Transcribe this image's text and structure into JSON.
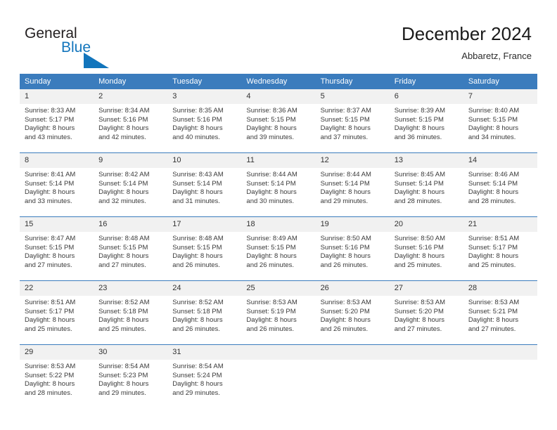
{
  "brand": {
    "name_dark": "General",
    "name_blue": "Blue",
    "accent_color": "#1275bc"
  },
  "header": {
    "title": "December 2024",
    "subtitle": "Abbaretz, France",
    "header_bg": "#3b7cbd",
    "daynum_bg": "#f1f1f1"
  },
  "weekday_headers": [
    "Sunday",
    "Monday",
    "Tuesday",
    "Wednesday",
    "Thursday",
    "Friday",
    "Saturday"
  ],
  "labels": {
    "sunrise": "Sunrise:",
    "sunset": "Sunset:",
    "daylight": "Daylight:"
  },
  "weeks": [
    [
      {
        "day": "1",
        "sunrise": "Sunrise: 8:33 AM",
        "sunset": "Sunset: 5:17 PM",
        "daylight_1": "Daylight: 8 hours",
        "daylight_2": "and 43 minutes."
      },
      {
        "day": "2",
        "sunrise": "Sunrise: 8:34 AM",
        "sunset": "Sunset: 5:16 PM",
        "daylight_1": "Daylight: 8 hours",
        "daylight_2": "and 42 minutes."
      },
      {
        "day": "3",
        "sunrise": "Sunrise: 8:35 AM",
        "sunset": "Sunset: 5:16 PM",
        "daylight_1": "Daylight: 8 hours",
        "daylight_2": "and 40 minutes."
      },
      {
        "day": "4",
        "sunrise": "Sunrise: 8:36 AM",
        "sunset": "Sunset: 5:15 PM",
        "daylight_1": "Daylight: 8 hours",
        "daylight_2": "and 39 minutes."
      },
      {
        "day": "5",
        "sunrise": "Sunrise: 8:37 AM",
        "sunset": "Sunset: 5:15 PM",
        "daylight_1": "Daylight: 8 hours",
        "daylight_2": "and 37 minutes."
      },
      {
        "day": "6",
        "sunrise": "Sunrise: 8:39 AM",
        "sunset": "Sunset: 5:15 PM",
        "daylight_1": "Daylight: 8 hours",
        "daylight_2": "and 36 minutes."
      },
      {
        "day": "7",
        "sunrise": "Sunrise: 8:40 AM",
        "sunset": "Sunset: 5:15 PM",
        "daylight_1": "Daylight: 8 hours",
        "daylight_2": "and 34 minutes."
      }
    ],
    [
      {
        "day": "8",
        "sunrise": "Sunrise: 8:41 AM",
        "sunset": "Sunset: 5:14 PM",
        "daylight_1": "Daylight: 8 hours",
        "daylight_2": "and 33 minutes."
      },
      {
        "day": "9",
        "sunrise": "Sunrise: 8:42 AM",
        "sunset": "Sunset: 5:14 PM",
        "daylight_1": "Daylight: 8 hours",
        "daylight_2": "and 32 minutes."
      },
      {
        "day": "10",
        "sunrise": "Sunrise: 8:43 AM",
        "sunset": "Sunset: 5:14 PM",
        "daylight_1": "Daylight: 8 hours",
        "daylight_2": "and 31 minutes."
      },
      {
        "day": "11",
        "sunrise": "Sunrise: 8:44 AM",
        "sunset": "Sunset: 5:14 PM",
        "daylight_1": "Daylight: 8 hours",
        "daylight_2": "and 30 minutes."
      },
      {
        "day": "12",
        "sunrise": "Sunrise: 8:44 AM",
        "sunset": "Sunset: 5:14 PM",
        "daylight_1": "Daylight: 8 hours",
        "daylight_2": "and 29 minutes."
      },
      {
        "day": "13",
        "sunrise": "Sunrise: 8:45 AM",
        "sunset": "Sunset: 5:14 PM",
        "daylight_1": "Daylight: 8 hours",
        "daylight_2": "and 28 minutes."
      },
      {
        "day": "14",
        "sunrise": "Sunrise: 8:46 AM",
        "sunset": "Sunset: 5:14 PM",
        "daylight_1": "Daylight: 8 hours",
        "daylight_2": "and 28 minutes."
      }
    ],
    [
      {
        "day": "15",
        "sunrise": "Sunrise: 8:47 AM",
        "sunset": "Sunset: 5:15 PM",
        "daylight_1": "Daylight: 8 hours",
        "daylight_2": "and 27 minutes."
      },
      {
        "day": "16",
        "sunrise": "Sunrise: 8:48 AM",
        "sunset": "Sunset: 5:15 PM",
        "daylight_1": "Daylight: 8 hours",
        "daylight_2": "and 27 minutes."
      },
      {
        "day": "17",
        "sunrise": "Sunrise: 8:48 AM",
        "sunset": "Sunset: 5:15 PM",
        "daylight_1": "Daylight: 8 hours",
        "daylight_2": "and 26 minutes."
      },
      {
        "day": "18",
        "sunrise": "Sunrise: 8:49 AM",
        "sunset": "Sunset: 5:15 PM",
        "daylight_1": "Daylight: 8 hours",
        "daylight_2": "and 26 minutes."
      },
      {
        "day": "19",
        "sunrise": "Sunrise: 8:50 AM",
        "sunset": "Sunset: 5:16 PM",
        "daylight_1": "Daylight: 8 hours",
        "daylight_2": "and 26 minutes."
      },
      {
        "day": "20",
        "sunrise": "Sunrise: 8:50 AM",
        "sunset": "Sunset: 5:16 PM",
        "daylight_1": "Daylight: 8 hours",
        "daylight_2": "and 25 minutes."
      },
      {
        "day": "21",
        "sunrise": "Sunrise: 8:51 AM",
        "sunset": "Sunset: 5:17 PM",
        "daylight_1": "Daylight: 8 hours",
        "daylight_2": "and 25 minutes."
      }
    ],
    [
      {
        "day": "22",
        "sunrise": "Sunrise: 8:51 AM",
        "sunset": "Sunset: 5:17 PM",
        "daylight_1": "Daylight: 8 hours",
        "daylight_2": "and 25 minutes."
      },
      {
        "day": "23",
        "sunrise": "Sunrise: 8:52 AM",
        "sunset": "Sunset: 5:18 PM",
        "daylight_1": "Daylight: 8 hours",
        "daylight_2": "and 25 minutes."
      },
      {
        "day": "24",
        "sunrise": "Sunrise: 8:52 AM",
        "sunset": "Sunset: 5:18 PM",
        "daylight_1": "Daylight: 8 hours",
        "daylight_2": "and 26 minutes."
      },
      {
        "day": "25",
        "sunrise": "Sunrise: 8:53 AM",
        "sunset": "Sunset: 5:19 PM",
        "daylight_1": "Daylight: 8 hours",
        "daylight_2": "and 26 minutes."
      },
      {
        "day": "26",
        "sunrise": "Sunrise: 8:53 AM",
        "sunset": "Sunset: 5:20 PM",
        "daylight_1": "Daylight: 8 hours",
        "daylight_2": "and 26 minutes."
      },
      {
        "day": "27",
        "sunrise": "Sunrise: 8:53 AM",
        "sunset": "Sunset: 5:20 PM",
        "daylight_1": "Daylight: 8 hours",
        "daylight_2": "and 27 minutes."
      },
      {
        "day": "28",
        "sunrise": "Sunrise: 8:53 AM",
        "sunset": "Sunset: 5:21 PM",
        "daylight_1": "Daylight: 8 hours",
        "daylight_2": "and 27 minutes."
      }
    ],
    [
      {
        "day": "29",
        "sunrise": "Sunrise: 8:53 AM",
        "sunset": "Sunset: 5:22 PM",
        "daylight_1": "Daylight: 8 hours",
        "daylight_2": "and 28 minutes."
      },
      {
        "day": "30",
        "sunrise": "Sunrise: 8:54 AM",
        "sunset": "Sunset: 5:23 PM",
        "daylight_1": "Daylight: 8 hours",
        "daylight_2": "and 29 minutes."
      },
      {
        "day": "31",
        "sunrise": "Sunrise: 8:54 AM",
        "sunset": "Sunset: 5:24 PM",
        "daylight_1": "Daylight: 8 hours",
        "daylight_2": "and 29 minutes."
      },
      {
        "day": "",
        "sunrise": "",
        "sunset": "",
        "daylight_1": "",
        "daylight_2": ""
      },
      {
        "day": "",
        "sunrise": "",
        "sunset": "",
        "daylight_1": "",
        "daylight_2": ""
      },
      {
        "day": "",
        "sunrise": "",
        "sunset": "",
        "daylight_1": "",
        "daylight_2": ""
      },
      {
        "day": "",
        "sunrise": "",
        "sunset": "",
        "daylight_1": "",
        "daylight_2": ""
      }
    ]
  ]
}
